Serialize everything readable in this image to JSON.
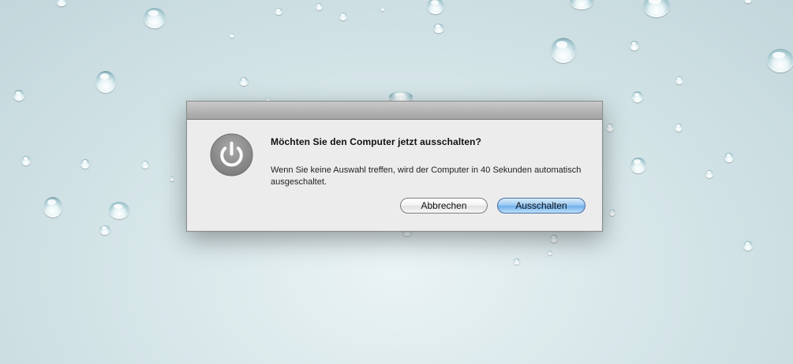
{
  "dialog": {
    "title": "Möchten Sie den Computer jetzt ausschalten?",
    "message": "Wenn Sie keine Auswahl treffen, wird der Computer in 40 Sekunden automatisch ausgeschaltet.",
    "icon": "power-icon",
    "buttons": {
      "cancel_label": "Abbrechen",
      "confirm_label": "Ausschalten"
    }
  },
  "colors": {
    "desktop_background": "#d6e6e9",
    "dialog_background": "#ececec",
    "default_button": "#6fb0ea",
    "icon_gray": "#8e8e8e"
  }
}
